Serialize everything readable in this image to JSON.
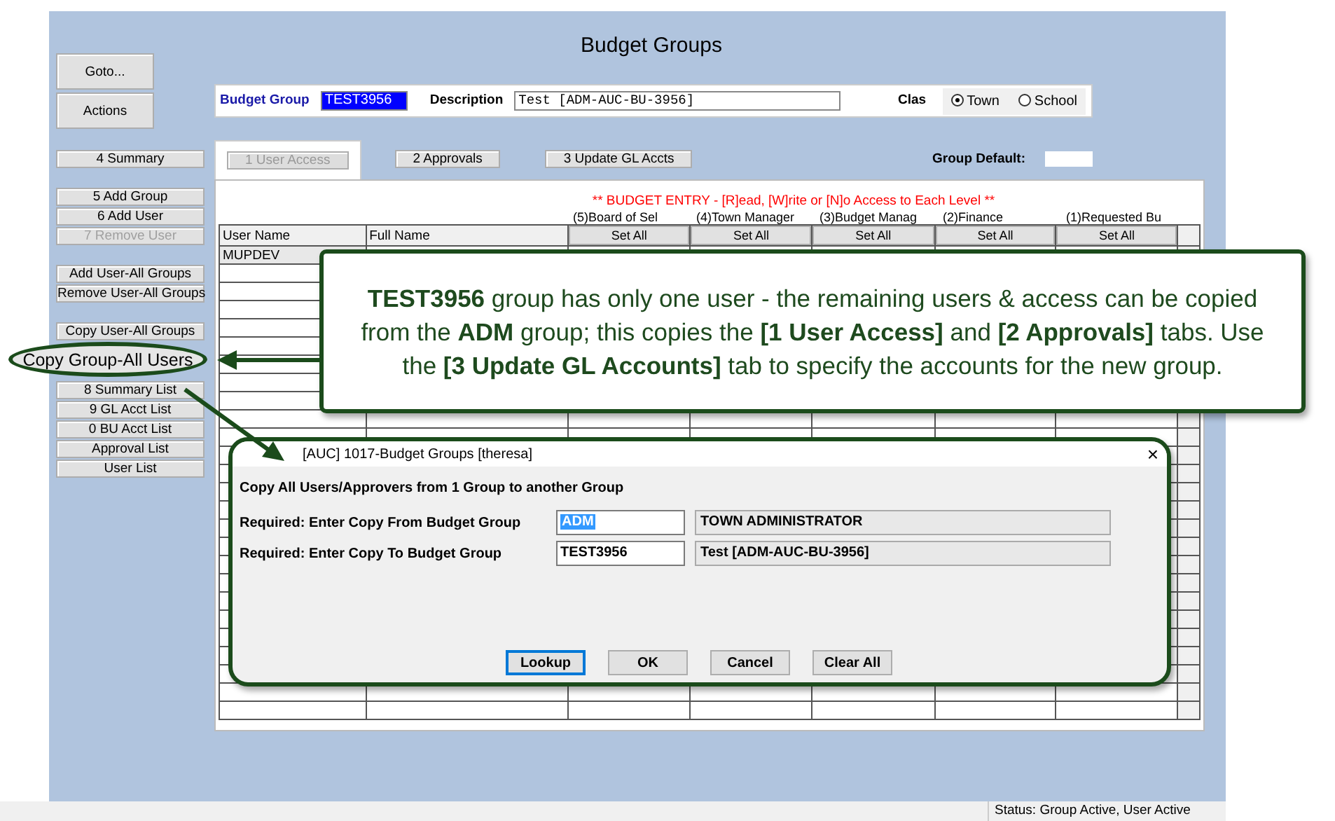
{
  "window": {
    "title": "Budget Groups"
  },
  "sidebar": {
    "top_buttons": [
      "Goto...",
      "Actions"
    ],
    "sections": [
      [
        {
          "label": "4 Summary",
          "disabled": false,
          "highlighted": false
        }
      ],
      [
        {
          "label": "5 Add Group",
          "disabled": false,
          "highlighted": false
        },
        {
          "label": "6 Add User",
          "disabled": false,
          "highlighted": false
        },
        {
          "label": "7 Remove User",
          "disabled": true,
          "highlighted": false
        }
      ],
      [
        {
          "label": "Add User-All Groups",
          "disabled": false,
          "highlighted": false
        },
        {
          "label": "Remove User-All Groups",
          "disabled": false,
          "highlighted": false
        }
      ],
      [
        {
          "label": "Copy User-All Groups",
          "disabled": false,
          "highlighted": false
        },
        {
          "label": "Copy Group-All Users",
          "disabled": false,
          "highlighted": true
        },
        {
          "label": "8 Summary List",
          "disabled": false,
          "highlighted": false
        },
        {
          "label": "9 GL Acct List",
          "disabled": false,
          "highlighted": false
        },
        {
          "label": "0 BU Acct List",
          "disabled": false,
          "highlighted": false
        },
        {
          "label": "Approval List",
          "disabled": false,
          "highlighted": false
        },
        {
          "label": "User List",
          "disabled": false,
          "highlighted": false
        }
      ]
    ]
  },
  "header": {
    "budget_group_label": "Budget Group",
    "budget_group_value": "TEST3956",
    "description_label": "Description",
    "description_value": "Test [ADM-AUC-BU-3956]",
    "class_label": "Clas",
    "class_options": [
      {
        "label": "Town",
        "selected": true
      },
      {
        "label": "School",
        "selected": false
      }
    ]
  },
  "tabs": [
    {
      "label": "1 User Access",
      "selected": true
    },
    {
      "label": "2 Approvals",
      "selected": false
    },
    {
      "label": "3 Update GL Accts",
      "selected": false
    }
  ],
  "group_default": {
    "label": "Group Default:"
  },
  "grid": {
    "banner": "** BUDGET ENTRY - [R]ead, [W]rite or [N]o Access to Each Level **",
    "levels": [
      "(5)Board of Sel",
      "(4)Town Manager",
      "(3)Budget Manag",
      "(2)Finance",
      "(1)Requested Bu"
    ],
    "columns": [
      "User Name",
      "Full Name"
    ],
    "set_all": [
      "Set All",
      "Set All",
      "Set All",
      "Set All",
      "Set All"
    ],
    "rows": [
      {
        "user_name": "MUPDEV"
      }
    ]
  },
  "callout": {
    "text": "**TEST3956** group has only one user - the remaining users & access can be copied from the **ADM** group; this copies the **[1 User Access]** and **[2 Approvals]** tabs. Use the **[3 Update GL Accounts]** tab to specify the accounts for the new group."
  },
  "dialog": {
    "title": "[AUC] 1017-Budget Groups [theresa]",
    "close_icon": "×",
    "heading": "Copy All Users/Approvers from 1 Group to another Group",
    "fields": [
      {
        "label": "Required: Enter Copy From Budget Group",
        "value": "ADM",
        "text_selected": true,
        "description": "TOWN ADMINISTRATOR"
      },
      {
        "label": "Required: Enter Copy To Budget Group",
        "value": "TEST3956",
        "text_selected": false,
        "description": "Test [ADM-AUC-BU-3956]"
      }
    ],
    "buttons": [
      {
        "label": "Lookup",
        "default": true
      },
      {
        "label": "OK",
        "default": false
      },
      {
        "label": "Cancel",
        "default": false
      },
      {
        "label": "Clear All",
        "default": false
      }
    ]
  },
  "status_bar": "Status: Group Active, User Active"
}
